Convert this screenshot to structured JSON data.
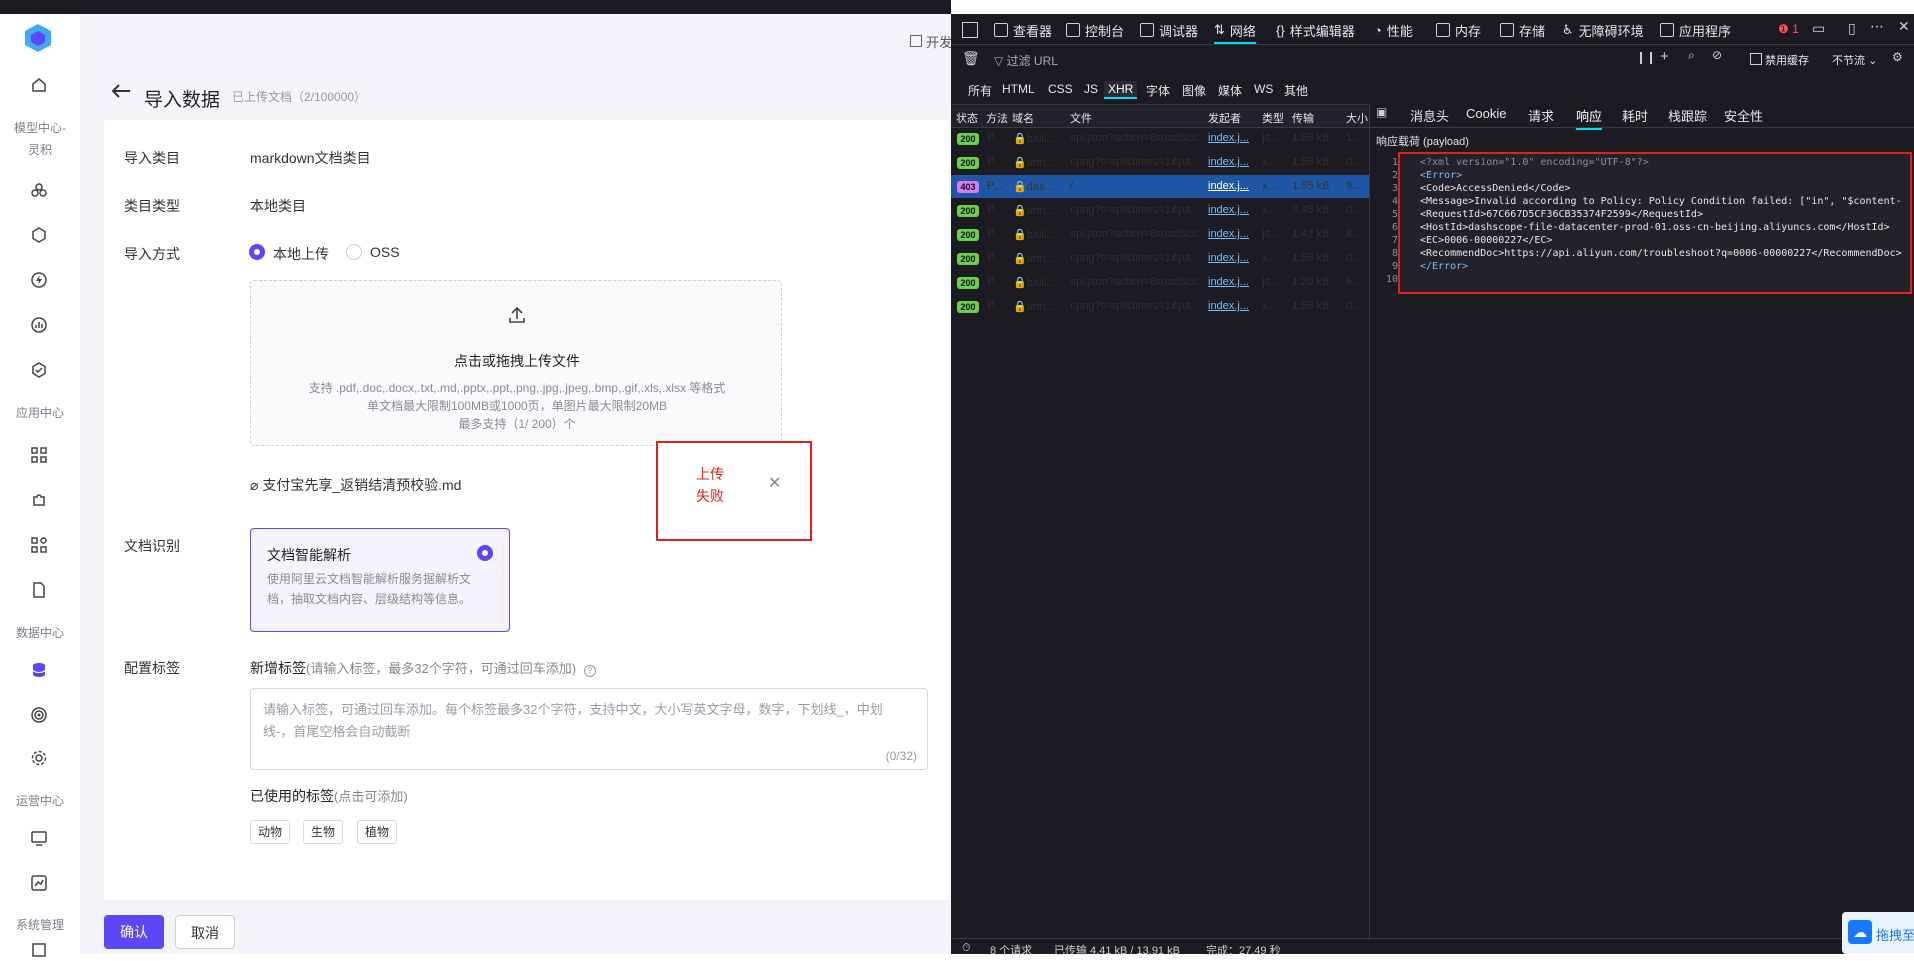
{
  "sidebar": {
    "sections": [
      "模型中心-\n灵积",
      "应用中心",
      "数据中心",
      "运营中心",
      "系统管理"
    ]
  },
  "page": {
    "title": "导入数据",
    "subtitle": "已上传文档（2/100000）",
    "top_right": "开发"
  },
  "form": {
    "category_label": "导入类目",
    "category_value": "markdown文档类目",
    "type_label": "类目类型",
    "type_value": "本地类目",
    "method_label": "导入方式",
    "method_options": [
      "本地上传",
      "OSS"
    ],
    "upload_title": "点击或拖拽上传文件",
    "upload_hint_1": "支持 .pdf,.doc,.docx,.txt,.md,.pptx,.ppt,.png,.jpg,.jpeg,.bmp,.gif,.xls,.xlsx 等格式",
    "upload_hint_2": "单文档最大限制100MB或1000页，单图片最大限制20MB",
    "upload_hint_3": "最多支持（1/ 200）个",
    "file_name": "支付宝先享_返销结清预校验.md",
    "upload_failed": "上传\n失败",
    "recog_label": "文档识别",
    "recog_title": "文档智能解析",
    "recog_desc": "使用阿里云文档智能解析服务据解析文档，抽取文档内容、层级结构等信息。",
    "tag_label": "配置标签",
    "new_tag_title": "新增标签",
    "new_tag_hint": "(请输入标签，最多32个字符，可通过回车添加)",
    "tag_placeholder": "请输入标签，可通过回车添加。每个标签最多32个字符，支持中文，大小写英文字母，数字，下划线_，中划线-，首尾空格会自动截断",
    "tag_counter": "(0/32)",
    "used_tags_title": "已使用的标签",
    "used_tags_hint": "(点击可添加)",
    "used_tags": [
      "动物",
      "生物",
      "植物"
    ],
    "confirm": "确认",
    "cancel": "取消"
  },
  "devtools": {
    "tools": [
      "查看器",
      "控制台",
      "调试器",
      "网络",
      "样式编辑器",
      "性能",
      "内存",
      "存储",
      "无障碍环境",
      "应用程序"
    ],
    "error_count": "1",
    "filter_placeholder": "过滤 URL",
    "disable_cache": "禁用缓存",
    "throttle": "不节流",
    "type_filters": [
      "所有",
      "HTML",
      "CSS",
      "JS",
      "XHR",
      "字体",
      "图像",
      "媒体",
      "WS",
      "其他"
    ],
    "columns": [
      "状态",
      "方法",
      "域名",
      "文件",
      "发起者",
      "类型",
      "传输",
      "大小"
    ],
    "rows": [
      {
        "status": "200",
        "method": "P...",
        "domain": "baili...",
        "file": "api.json?action=BroadScc",
        "initiator": "index.j...",
        "type": "js...",
        "transfer": "1.65 kB",
        "size": "1..."
      },
      {
        "status": "200",
        "method": "P...",
        "domain": "arm...",
        "file": "r.png?t=api&times=1&pa",
        "initiator": "index.j...",
        "type": "x...",
        "transfer": "1.55 kB",
        "size": "0..."
      },
      {
        "status": "403",
        "method": "P...",
        "domain": "das...",
        "file": "/",
        "initiator": "index.j...",
        "type": "x...",
        "transfer": "1.55 kB",
        "size": "9..."
      },
      {
        "status": "200",
        "method": "P...",
        "domain": "arm...",
        "file": "r.png?t=api&times=1&pa",
        "initiator": "index.j...",
        "type": "x...",
        "transfer": "3.45 kB",
        "size": "0..."
      },
      {
        "status": "200",
        "method": "P...",
        "domain": "baili...",
        "file": "api.json?action=BroadScc",
        "initiator": "index.j...",
        "type": "js...",
        "transfer": "1.42 kB",
        "size": "8..."
      },
      {
        "status": "200",
        "method": "P...",
        "domain": "arm...",
        "file": "r.png?t=api&times=1&pa",
        "initiator": "index.j...",
        "type": "x...",
        "transfer": "1.55 kB",
        "size": "0..."
      },
      {
        "status": "200",
        "method": "P...",
        "domain": "baili...",
        "file": "api.json?action=BroadScc",
        "initiator": "index.j...",
        "type": "js...",
        "transfer": "1.20 kB",
        "size": "6..."
      },
      {
        "status": "200",
        "method": "P...",
        "domain": "arm...",
        "file": "r.png?t=api&times=1&pa",
        "initiator": "index.j...",
        "type": "x...",
        "transfer": "1.55 kB",
        "size": "0..."
      }
    ],
    "detail_tabs": [
      "消息头",
      "Cookie",
      "请求",
      "响应",
      "耗时",
      "栈跟踪",
      "安全性"
    ],
    "payload_title": "响应载荷 (payload)",
    "code_lines": [
      "<?xml version=\"1.0\" encoding=\"UTF-8\"?>",
      "<Error>",
      "  <Code>AccessDenied</Code>",
      "  <Message>Invalid according to Policy: Policy Condition failed: [\"in\", \"$content-",
      "  <RequestId>67C667D5CF36CB35374F2599</RequestId>",
      "  <HostId>dashscope-file-datacenter-prod-01.oss-cn-beijing.aliyuncs.com</HostId>",
      "  <EC>0006-00000227</EC>",
      "  <RecommendDoc>https://api.aliyun.com/troubleshoot?q=0006-00000227</RecommendDoc>",
      "</Error>",
      ""
    ],
    "footer": {
      "requests": "8 个请求",
      "transferred": "已传输 4.41 kB / 13.91 kB",
      "finish": "完成：27.49 秒"
    },
    "float_label": "拖拽至"
  },
  "colors": {
    "accent": "#5b47f5",
    "error": "#e02020",
    "dev_bg": "#1c1b22",
    "selected_row": "#1f57a6"
  }
}
